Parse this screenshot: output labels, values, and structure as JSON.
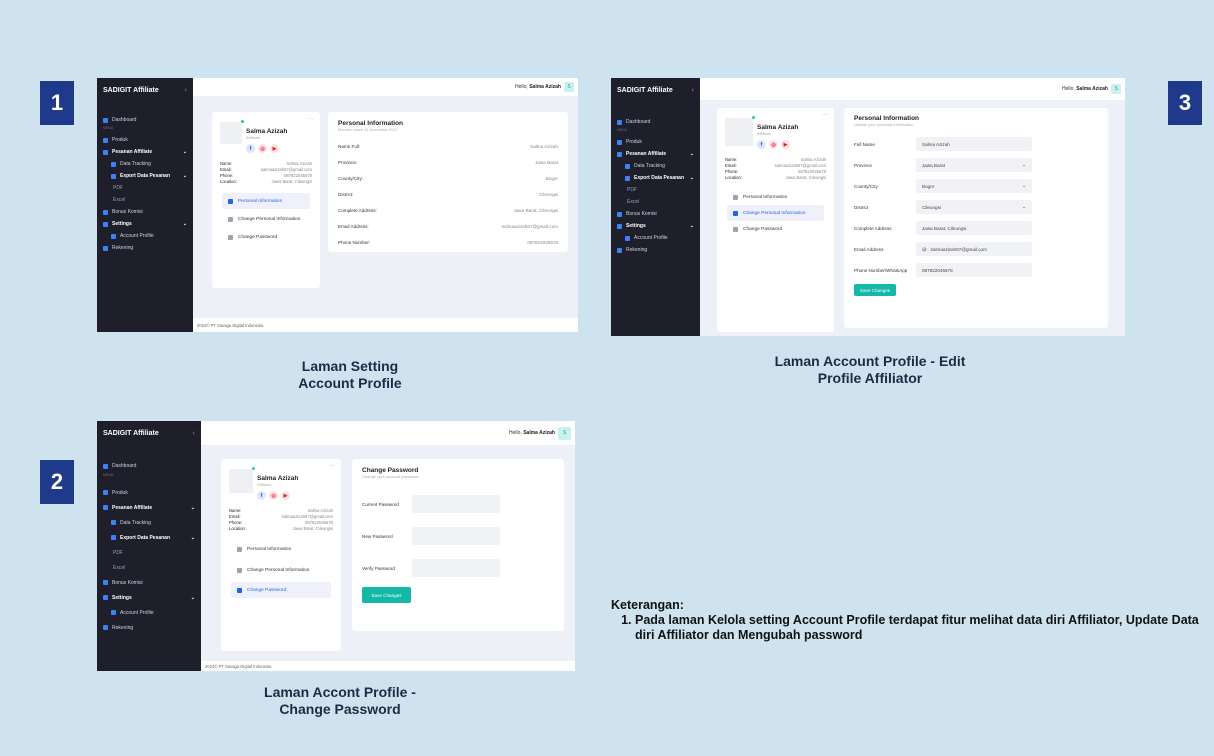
{
  "badges": [
    "1",
    "2",
    "3"
  ],
  "captions": {
    "s1": [
      "Laman Setting",
      "Account Profile"
    ],
    "s2": [
      "Laman Accont Profile -",
      "Change Password"
    ],
    "s3": [
      "Laman Account Profile - Edit",
      "Profile Affiliator"
    ]
  },
  "note": {
    "title": "Keterangan:",
    "items": [
      "Pada laman Kelola setting Account Profile terdapat fitur melihat data diri Affiliator, Update Data diri Affiliator dan Mengubah password"
    ]
  },
  "app": {
    "brand": "SADIGIT Affiliate",
    "collapse_icon": "chevron-left-icon",
    "hello": "Hello,",
    "user": "Salma Azizah",
    "avatar": "S",
    "menu_label": "MENU",
    "sidebar": {
      "dashboard": "Dashboard",
      "produk": "Produk",
      "pesanan": "Pesanan Affiliate",
      "tracking": "Data Tracking",
      "export": "Export Data Pesanan",
      "pdf": "PDF",
      "excel": "Excel",
      "bonus": "Bonus Komisi",
      "settings": "Settings",
      "account": "Account Profile",
      "rekening": "Rekening"
    },
    "footer": "2024© PT Savaga Digital Indonesia"
  },
  "profile": {
    "name": "Salma Azizah",
    "role": "Affiliator",
    "labels": {
      "name": "Name:",
      "email": "Email:",
      "phone": "Phone:",
      "location": "Location:"
    },
    "values": {
      "name": "Salma Azizah",
      "email": "salmaazizah67@gmail.com",
      "phone": "087822045678",
      "location": "Jawa Barat, Cileungsi"
    },
    "options": {
      "personal": "Personal Information",
      "change_personal": "Change Personal Information",
      "change_password": "Change Password"
    }
  },
  "personal_info": {
    "title": "Personal Information",
    "subtitle": "Member since 11 December 2017",
    "rows": [
      {
        "k": "Name Full:",
        "v": "Salma Azizah"
      },
      {
        "k": "Province:",
        "v": "Jawa Barat"
      },
      {
        "k": "County/City:",
        "v": "Bogor"
      },
      {
        "k": "District:",
        "v": "Cileungsi"
      },
      {
        "k": "Complete Address:",
        "v": "Jawa Barat, Cileungsi"
      },
      {
        "k": "Email Address:",
        "v": "salmaazizah67@gmail.com"
      },
      {
        "k": "Phone Number:",
        "v": "087822045678"
      }
    ]
  },
  "change_password": {
    "title": "Change Password",
    "subtitle": "Change your account password",
    "current": "Current Password",
    "new": "New Password",
    "verify": "Verify Password",
    "button": "Save Changes"
  },
  "edit_form": {
    "title": "Personal Information",
    "subtitle": "Update your personal information",
    "fields": [
      {
        "label": "Full Name",
        "value": "Salma Azizah",
        "select": false
      },
      {
        "label": "Province",
        "value": "Jawa Barat",
        "select": true
      },
      {
        "label": "County/City",
        "value": "Bogor",
        "select": true
      },
      {
        "label": "District",
        "value": "Cileungsi",
        "select": true
      },
      {
        "label": "Complete Address",
        "value": "Jawa Barat, Cileungsi",
        "select": false
      },
      {
        "label": "Email Address",
        "value": "salmaazizah67@gmail.com",
        "select": false
      },
      {
        "label": "Phone Number/WhatsApp",
        "value": "087822045678",
        "select": false
      }
    ],
    "button": "Save Changes"
  },
  "colors": {
    "accent": "#14b8a6",
    "badge": "#1f3a8a",
    "sidebar": "#1e1f2b",
    "background": "#cfe3ef"
  }
}
